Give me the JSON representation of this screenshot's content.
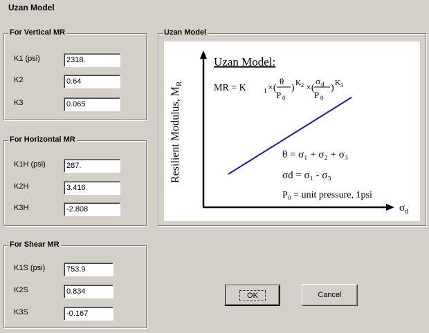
{
  "window": {
    "title": "Uzan Model"
  },
  "vertical": {
    "legend": "For Vertical MR",
    "fields": [
      {
        "label": "K1 (psi)",
        "value": "2318."
      },
      {
        "label": "K2",
        "value": "0.64"
      },
      {
        "label": "K3",
        "value": "0.065"
      }
    ]
  },
  "horizontal": {
    "legend": "For Horizontal MR",
    "fields": [
      {
        "label": "K1H (psi)",
        "value": "287."
      },
      {
        "label": "K2H",
        "value": "3.416"
      },
      {
        "label": "K3H",
        "value": "-2.808"
      }
    ]
  },
  "shear": {
    "legend": "For Shear MR",
    "fields": [
      {
        "label": "K1S (psi)",
        "value": "753.9"
      },
      {
        "label": "K2S",
        "value": "0.834"
      },
      {
        "label": "K3S",
        "value": "-0.167"
      }
    ]
  },
  "model_panel": {
    "legend": "Uzan Model",
    "heading": "Uzan Model:",
    "equation_lhs": "MR = K",
    "ylabel": "Resilient Modulus, M",
    "ylabel_sub": "R",
    "xlabel": "σ",
    "xlabel_sub": "d",
    "theta_def": "θ = σ₁ + σ₂ + σ₃",
    "sigma_d_def": "σd = σ₁ - σ₃",
    "p0_def": "P₀ = unit pressure, 1psi"
  },
  "buttons": {
    "ok": "OK",
    "cancel": "Cancel"
  }
}
